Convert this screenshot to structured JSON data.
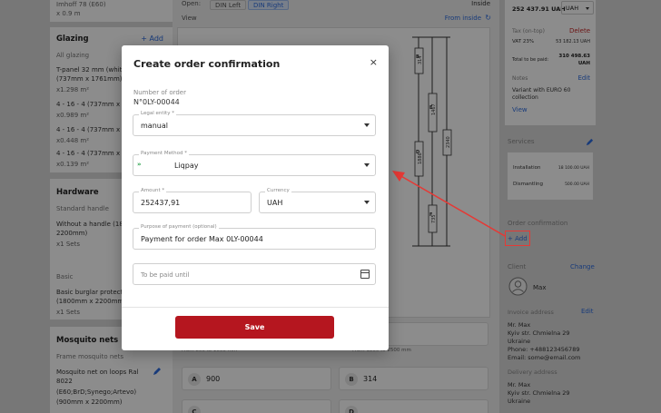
{
  "left": {
    "top_item": {
      "line1": "Imhoff 78 (E60)",
      "line2": "x 0.9 m"
    },
    "glazing": {
      "title": "Glazing",
      "add": "+ Add",
      "all": "All glazing",
      "items": [
        {
          "name": "T-panel 32 mm (white",
          "size": "(737mm x 1761mm)",
          "area": "x1.298 m²"
        },
        {
          "name": "4 - 16 - 4 (737mm x 13",
          "area": "x0.989 m²"
        },
        {
          "name": "4 - 16 - 4 (737mm x 60",
          "area": "x0.448 m²"
        },
        {
          "name": "4 - 16 - 4 (737mm x 18",
          "area": "x0.139 m²"
        }
      ]
    },
    "hardware": {
      "title": "Hardware",
      "standard": "Standard handle",
      "item_line1": "Without a handle (180",
      "item_line2": "2200mm)",
      "item_line3": "x1 Sets",
      "basic": "Basic",
      "basic_line1": "Basic burglar protecti",
      "basic_line2": "(1800mm x 2200mm)",
      "basic_line3": "x1 Sets"
    },
    "mosquito": {
      "title": "Mosquito nets",
      "frame": "Frame mosquito nets",
      "line1": "Mosquito net on loops Ral",
      "line2": "8022",
      "line3": "(E60;BrD;Synego;Artevo)",
      "line4": "(900mm x 2200mm)"
    }
  },
  "center": {
    "open_label": "Open:",
    "din_left": "DIN Left",
    "din_right": "DIN Right",
    "view_label": "View",
    "inside": "Inside",
    "from_inside": "From inside",
    "dims_vertical": [
      "314",
      "1467",
      "1886",
      "2340",
      "735"
    ],
    "dim_letters": [
      "B",
      "E",
      "D",
      "F"
    ],
    "cells": [
      {
        "letter": "A",
        "value": "900"
      },
      {
        "letter": "B",
        "value": "314"
      },
      {
        "letter": "C",
        "value": ""
      },
      {
        "letter": "D",
        "value": ""
      }
    ],
    "range_hint_left": "From 800 to 1000 mm",
    "range_hint_right": "From 1800 to 2500 mm"
  },
  "right": {
    "price": "252 437.91 UAH",
    "currency": "UAH",
    "tax_label": "Tax (on-top)",
    "delete": "Delete",
    "vat_label": "VAT 23%",
    "vat_value": "53 182.13 UAH",
    "total_label": "Total to be paid:",
    "total_value": "310 498.63 UAH",
    "notes_label": "Notes",
    "edit": "Edit",
    "note_text_1": "Variant with EURO 60",
    "note_text_2": "collection",
    "view": "View",
    "services_title": "Services",
    "service_1_label": "Installation",
    "service_1_value": "18 100.00 UAH",
    "service_2_label": "Dismantling",
    "service_2_value": "500.00 UAH",
    "order_conf_title": "Order confirmation",
    "order_conf_add": "+ Add",
    "client_title": "Client",
    "change": "Change",
    "client_name": "Max",
    "invoice_title": "Invoice address",
    "invoice_edit": "Edit",
    "addr_line1": "Mr. Max",
    "addr_line2": "Kyiv str. Chmielna 29",
    "addr_line3": "Ukraine",
    "addr_line4": "Phone: +488123456789",
    "addr_line5": "Email: some@email.com",
    "delivery_title": "Delivery address",
    "del_line1": "Mr. Max",
    "del_line2": "Kyiv str. Chmielna 29",
    "del_line3": "Ukraine"
  },
  "modal": {
    "title": "Create order confirmation",
    "close": "×",
    "order_label": "Number of order",
    "order_number": "N°0LY-00044",
    "legal_entity_label": "Legal entity *",
    "legal_entity_value": "manual",
    "payment_method_label": "Payment Method *",
    "payment_method_value": "Liqpay",
    "amount_label": "Amount *",
    "amount_value": "252437,91",
    "currency_label": "Currency",
    "currency_value": "UAH",
    "purpose_label": "Purpose of payment (optional)",
    "purpose_value": "Payment for order Max 0LY-00044",
    "paid_until_placeholder": "To be paid until",
    "save": "Save"
  },
  "colors": {
    "accent": "#2d6cdf",
    "save": "#b5161f",
    "annotation": "#e53935"
  }
}
